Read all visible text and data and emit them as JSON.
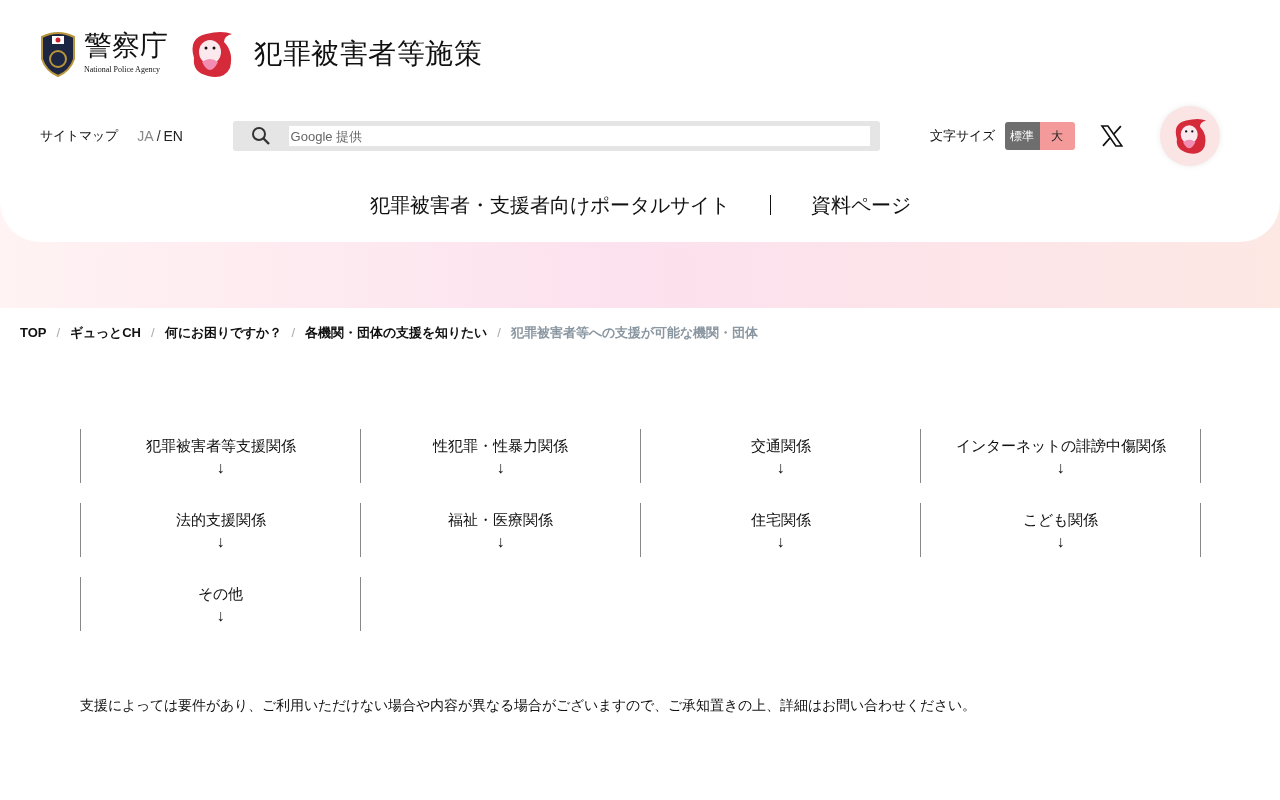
{
  "header": {
    "agency_name": "警察庁",
    "agency_name_en": "National Police Agency",
    "site_title": "犯罪被害者等施策",
    "sitemap_link": "サイトマップ",
    "languages": [
      {
        "label": "JA",
        "selected": true
      },
      {
        "label": "EN",
        "selected": false
      }
    ],
    "language_separator": "/",
    "search": {
      "placeholder": "Google 提供"
    },
    "font_size_label": "文字サイズ",
    "font_sizes": [
      {
        "label": "標準",
        "selected": true
      },
      {
        "label": "大",
        "selected": false
      }
    ],
    "nav": [
      "犯罪被害者・支援者向けポータルサイト",
      "資料ページ"
    ]
  },
  "breadcrumb": [
    {
      "label": "TOP",
      "current": false
    },
    {
      "label": "ギュっとCH",
      "current": false
    },
    {
      "label": "何にお困りですか？",
      "current": false
    },
    {
      "label": "各機関・団体の支援を知りたい",
      "current": false
    },
    {
      "label": "犯罪被害者等への支援が可能な機関・団体",
      "current": true
    }
  ],
  "breadcrumb_separator": "/",
  "categories": [
    {
      "label": "犯罪被害者等支援関係",
      "arrow": "↓"
    },
    {
      "label": "性犯罪・性暴力関係",
      "arrow": "↓"
    },
    {
      "label": "交通関係",
      "arrow": "↓"
    },
    {
      "label": "インターネットの誹謗中傷関係",
      "arrow": "↓"
    },
    {
      "label": "法的支援関係",
      "arrow": "↓"
    },
    {
      "label": "福祉・医療関係",
      "arrow": "↓"
    },
    {
      "label": "住宅関係",
      "arrow": "↓"
    },
    {
      "label": "こども関係",
      "arrow": "↓"
    },
    {
      "label": "その他",
      "arrow": "↓"
    }
  ],
  "notice": "支援によっては要件があり、ご利用いただけない場合や内容が異なる場合がございますので、ご承知置きの上、詳細はお問い合わせください。"
}
